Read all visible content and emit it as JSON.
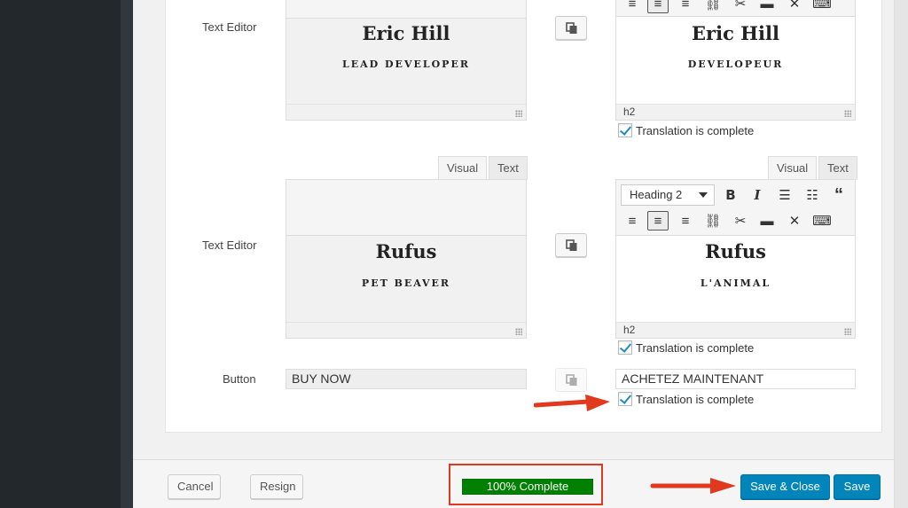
{
  "rows": [
    {
      "label": "Text Editor",
      "original": {
        "name": "Eric Hill",
        "subtitle": "LEAD DEVELOPER"
      },
      "translation": {
        "name": "Eric Hill",
        "subtitle": "DEVELOPEUR",
        "status": "h2",
        "complete_label": "Translation is complete"
      }
    },
    {
      "label": "Text Editor",
      "tabs": {
        "visual": "Visual",
        "text": "Text"
      },
      "original": {
        "name": "Rufus",
        "subtitle": "PET BEAVER"
      },
      "translation": {
        "format": "Heading 2",
        "name": "Rufus",
        "subtitle": "L'ANIMAL",
        "status": "h2",
        "complete_label": "Translation is complete"
      }
    },
    {
      "label": "Button",
      "original": {
        "value": "BUY NOW"
      },
      "translation": {
        "value": "ACHETEZ MAINTENANT",
        "complete_label": "Translation is complete"
      }
    }
  ],
  "footer": {
    "cancel_label": "Cancel",
    "resign_label": "Resign",
    "progress_label": "100% Complete",
    "progress_value": 1.0,
    "save_close_label": "Save & Close",
    "save_label": "Save"
  },
  "colors": {
    "primary": "#0085ba",
    "progress": "#008000",
    "annotation": "#e0391d",
    "check": "#1e8cbe"
  },
  "icons": {
    "toolbar_row1": [
      "bold-icon",
      "italic-icon",
      "bullet-list-icon",
      "numbered-list-icon",
      "blockquote-icon"
    ],
    "toolbar_row2": [
      "align-left-icon",
      "align-center-icon",
      "align-right-icon",
      "link-icon",
      "unlink-icon",
      "read-more-icon",
      "fullscreen-icon",
      "kitchen-sink-icon"
    ],
    "copy": "copy-icon"
  }
}
